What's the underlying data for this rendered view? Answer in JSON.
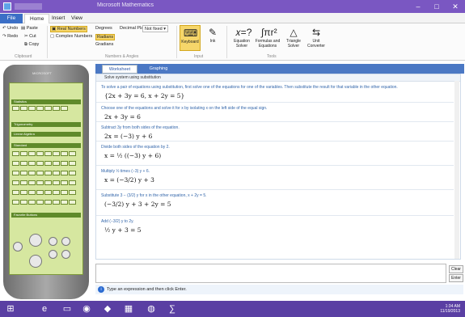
{
  "window": {
    "title": "Microsoft Mathematics",
    "min": "–",
    "max": "□",
    "close": "✕"
  },
  "ribbon_tabs": [
    {
      "label": "File"
    },
    {
      "label": "Home"
    },
    {
      "label": "Insert"
    },
    {
      "label": "View"
    }
  ],
  "clipboard": {
    "undo": "Undo",
    "paste": "Paste",
    "redo": "Redo",
    "cut": "Cut",
    "copy": "Copy",
    "group": "Clipboard"
  },
  "numbers_angles": {
    "real_numbers": "Real Numbers",
    "complex_numbers": "Complex Numbers",
    "degrees": "Degrees",
    "radians": "Radians",
    "gradians": "Gradians",
    "decimal_places_label": "Decimal Places:",
    "decimal_places_value": "Not fixed",
    "group": "Numbers & Angles"
  },
  "input_group": {
    "keyboard": "Keyboard",
    "ink": "Ink",
    "group": "Input"
  },
  "tools_group": {
    "equation_solver": "Equation Solver",
    "formulas": "Formulas and Equations",
    "triangle_solver": "Triangle Solver",
    "unit_converter": "Unit Converter",
    "group": "Tools"
  },
  "calculator": {
    "brand": "MICROSOFT",
    "sections": [
      "Statistics",
      "Trigonometry",
      "Linear Algebra",
      "Standard",
      "Favorite Buttons"
    ]
  },
  "work_tabs": {
    "worksheet": "Worksheet",
    "graphing": "Graphing"
  },
  "steps_header": "Solve system using substitution",
  "steps": [
    {
      "desc": "To solve a pair of equations using substitution, first solve one of the equations for one of the variables. Then substitute the result for that variable in the other equation.",
      "eq": "{2x + 3y = 6, x + 2y = 5}"
    },
    {
      "desc": "Choose one of the equations and solve it for x by isolating x on the left side of the equal sign.",
      "eq": "2x + 3y = 6"
    },
    {
      "desc": "Subtract 3y from both sides of the equation.",
      "eq": "2x = (−3) y + 6"
    },
    {
      "desc": "Divide both sides of the equation by 2.",
      "eq": "x = ½ ((−3) y + 6)"
    },
    {
      "desc": "Multiply ½ times (−3) y + 6.",
      "eq": "x = (−3/2) y + 3"
    },
    {
      "desc": "Substitute 3 − (3/2) y for x in the other equation, x + 2y = 5.",
      "eq": "(−3/2) y + 3 + 2y = 5"
    },
    {
      "desc": "Add (−3/2) y to 2y.",
      "eq": "½ y + 3 = 5"
    }
  ],
  "input": {
    "clear": "Clear",
    "enter": "Enter"
  },
  "hint": "Type an expression and then click Enter.",
  "tray": {
    "time": "1:34 AM",
    "date": "11/19/2013"
  }
}
